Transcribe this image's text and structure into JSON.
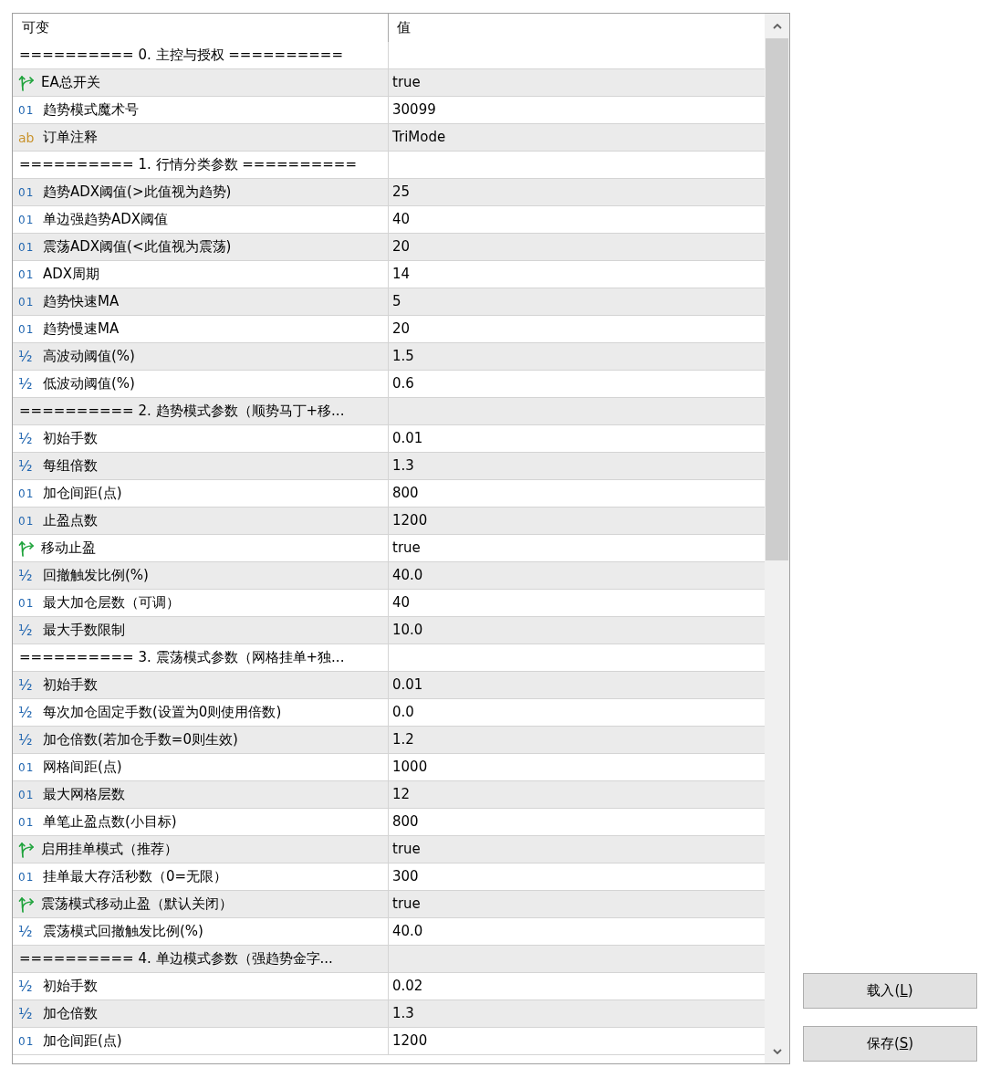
{
  "columns": [
    {
      "label": "可变"
    },
    {
      "label": "值"
    }
  ],
  "rows": [
    {
      "kind": "section",
      "title": "========== 0. 主控与授权 =========="
    },
    {
      "kind": "bool",
      "name": "EA总开关",
      "value": "true"
    },
    {
      "kind": "int",
      "glyph": "01",
      "name": "趋势模式魔术号",
      "value": "30099"
    },
    {
      "kind": "string",
      "glyph": "ab",
      "name": "订单注释",
      "value": "TriMode"
    },
    {
      "kind": "section",
      "title": "========== 1. 行情分类参数 =========="
    },
    {
      "kind": "int",
      "glyph": "01",
      "name": "趋势ADX阈值(>此值视为趋势)",
      "value": "25"
    },
    {
      "kind": "int",
      "glyph": "01",
      "name": "单边强趋势ADX阈值",
      "value": "40"
    },
    {
      "kind": "int",
      "glyph": "01",
      "name": "震荡ADX阈值(<此值视为震荡)",
      "value": "20"
    },
    {
      "kind": "int",
      "glyph": "01",
      "name": "ADX周期",
      "value": "14"
    },
    {
      "kind": "int",
      "glyph": "01",
      "name": "趋势快速MA",
      "value": "5"
    },
    {
      "kind": "int",
      "glyph": "01",
      "name": "趋势慢速MA",
      "value": "20"
    },
    {
      "kind": "double",
      "glyph": "½",
      "name": "高波动阈值(%)",
      "value": "1.5"
    },
    {
      "kind": "double",
      "glyph": "½",
      "name": "低波动阈值(%)",
      "value": "0.6"
    },
    {
      "kind": "section",
      "title": "========== 2. 趋势模式参数（顺势马丁+移..."
    },
    {
      "kind": "double",
      "glyph": "½",
      "name": "初始手数",
      "value": "0.01"
    },
    {
      "kind": "double",
      "glyph": "½",
      "name": "每组倍数",
      "value": "1.3"
    },
    {
      "kind": "int",
      "glyph": "01",
      "name": "加仓间距(点)",
      "value": "800"
    },
    {
      "kind": "int",
      "glyph": "01",
      "name": "止盈点数",
      "value": "1200"
    },
    {
      "kind": "bool",
      "name": "移动止盈",
      "value": "true"
    },
    {
      "kind": "double",
      "glyph": "½",
      "name": "回撤触发比例(%)",
      "value": "40.0"
    },
    {
      "kind": "int",
      "glyph": "01",
      "name": "最大加仓层数（可调）",
      "value": "40"
    },
    {
      "kind": "double",
      "glyph": "½",
      "name": "最大手数限制",
      "value": "10.0"
    },
    {
      "kind": "section",
      "title": "========== 3. 震荡模式参数（网格挂单+独..."
    },
    {
      "kind": "double",
      "glyph": "½",
      "name": "初始手数",
      "value": "0.01"
    },
    {
      "kind": "double",
      "glyph": "½",
      "name": "每次加仓固定手数(设置为0则使用倍数)",
      "value": "0.0"
    },
    {
      "kind": "double",
      "glyph": "½",
      "name": "加仓倍数(若加仓手数=0则生效)",
      "value": "1.2"
    },
    {
      "kind": "int",
      "glyph": "01",
      "name": "网格间距(点)",
      "value": "1000"
    },
    {
      "kind": "int",
      "glyph": "01",
      "name": "最大网格层数",
      "value": "12"
    },
    {
      "kind": "int",
      "glyph": "01",
      "name": "单笔止盈点数(小目标)",
      "value": "800"
    },
    {
      "kind": "bool",
      "name": "启用挂单模式（推荐）",
      "value": "true"
    },
    {
      "kind": "int",
      "glyph": "01",
      "name": "挂单最大存活秒数（0=无限）",
      "value": "300"
    },
    {
      "kind": "bool",
      "name": "震荡模式移动止盈（默认关闭）",
      "value": "true"
    },
    {
      "kind": "double",
      "glyph": "½",
      "name": "震荡模式回撤触发比例(%)",
      "value": "40.0"
    },
    {
      "kind": "section",
      "title": "========== 4. 单边模式参数（强趋势金字..."
    },
    {
      "kind": "double",
      "glyph": "½",
      "name": "初始手数",
      "value": "0.02"
    },
    {
      "kind": "double",
      "glyph": "½",
      "name": "加仓倍数",
      "value": "1.3"
    },
    {
      "kind": "int",
      "glyph": "01",
      "name": "加仓间距(点)",
      "value": "1200"
    }
  ],
  "buttons": [
    {
      "label": "载入(",
      "access_key": "L",
      "label_end": ")"
    },
    {
      "label": "保存(",
      "access_key": "S",
      "label_end": ")"
    }
  ]
}
